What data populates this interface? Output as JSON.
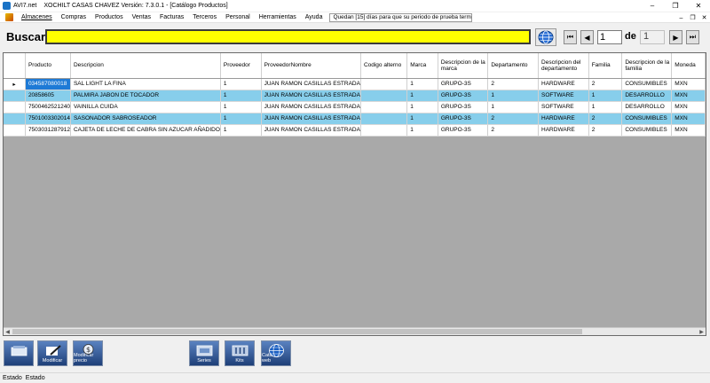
{
  "window": {
    "app_label": "AVI7.net",
    "title": "XOCHILT CASAS CHAVEZ Versión: 7.3.0.1 - [Catálogo Productos]"
  },
  "menu": {
    "items": [
      "Almacenes",
      "Compras",
      "Productos",
      "Ventas",
      "Facturas",
      "Terceros",
      "Personal",
      "Herramientas",
      "Ayuda"
    ],
    "notice": "Quedan [15] días para que su periodo de prueba termine."
  },
  "search": {
    "label": "Buscar",
    "value": "",
    "page_current": "1",
    "page_separator": "de",
    "page_total": "1"
  },
  "grid": {
    "columns": [
      "Producto",
      "Descripcion",
      "Proveedor",
      "ProveedorNombre",
      "Codigo alterno",
      "Marca",
      "Descripcion de la marca",
      "Departamento",
      "Descripcion del departamento",
      "Familia",
      "Descripcion de la familia",
      "Moneda"
    ],
    "rows": [
      [
        "034587080018",
        "SAL LIGHT LA FINA",
        "1",
        "JUAN RAMON CASILLAS ESTRADA",
        "",
        "1",
        "GRUPO-3S",
        "2",
        "HARDWARE",
        "2",
        "CONSUMIBLES",
        "MXN"
      ],
      [
        "20858605",
        "PALMIRA JABON DE TOCADOR",
        "1",
        "JUAN RAMON CASILLAS ESTRADA",
        "",
        "1",
        "GRUPO-3S",
        "1",
        "SOFTWARE",
        "1",
        "DESARROLLO",
        "MXN"
      ],
      [
        "7500462521240",
        "VAINILLA CUIDA",
        "1",
        "JUAN RAMON CASILLAS ESTRADA",
        "",
        "1",
        "GRUPO-3S",
        "1",
        "SOFTWARE",
        "1",
        "DESARROLLO",
        "MXN"
      ],
      [
        "7501003302014",
        "SASONADOR SABROSEADOR",
        "1",
        "JUAN RAMON CASILLAS ESTRADA",
        "",
        "1",
        "GRUPO-3S",
        "2",
        "HARDWARE",
        "2",
        "CONSUMIBLES",
        "MXN"
      ],
      [
        "7503031287912",
        "CAJETA DE LECHE DE CABRA SIN AZUCAR AÑADIDO",
        "1",
        "JUAN RAMON CASILLAS ESTRADA",
        "",
        "1",
        "GRUPO-3S",
        "2",
        "HARDWARE",
        "2",
        "CONSUMIBLES",
        "MXN"
      ]
    ]
  },
  "toolbar": {
    "buttons": [
      {
        "label": "",
        "icon": "new-icon"
      },
      {
        "label": "Modificar",
        "icon": "edit-icon"
      },
      {
        "label": "Modificar precio",
        "icon": "price-icon"
      },
      {
        "label": "Series",
        "icon": "series-icon"
      },
      {
        "label": "Kits",
        "icon": "kit-icon"
      },
      {
        "label": "Catálogo web",
        "icon": "globe-icon"
      }
    ]
  },
  "status": {
    "label": "Estado",
    "value": "Estado"
  },
  "colors": {
    "search_bg": "#ffff00",
    "alt_row": "#87ceeb",
    "selection": "#1e7ad6"
  }
}
